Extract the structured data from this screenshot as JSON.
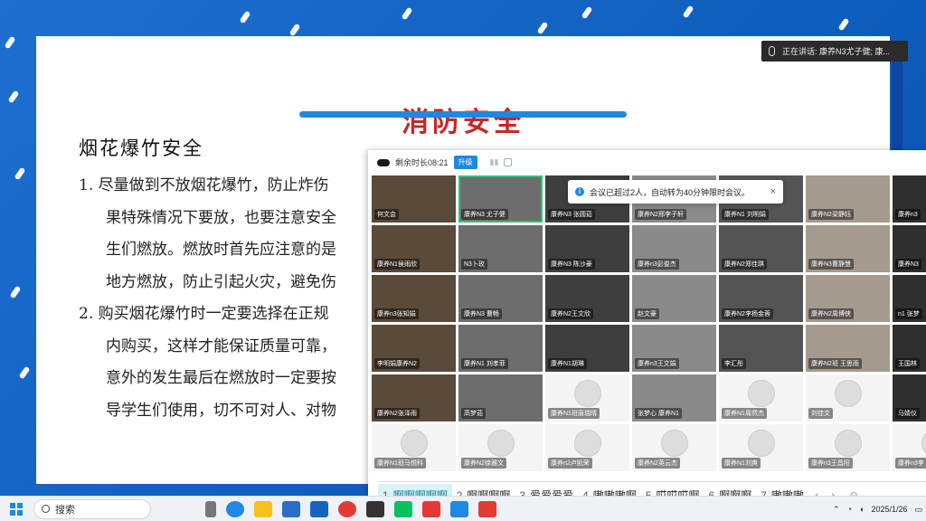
{
  "slide": {
    "title": "消防安全",
    "subtitle": "烟花爆竹安全",
    "lines": [
      "1.  尽量做到不放烟花爆竹，防止炸伤",
      "果特殊情况下要放，也要注意安全",
      "生们燃放。燃放时首先应注意的是",
      "地方燃放，防止引起火灾，避免伤",
      "2.  购买烟花爆竹时一定要选择在正规",
      "内购买，这样才能保证质量可靠，",
      "意外的发生最后在燃放时一定要按",
      "导学生们使用，切不可对人、对物"
    ]
  },
  "speaking": {
    "text": "正在讲话: 康养N3尤子健; 康..."
  },
  "meeting": {
    "remaining": "剩余时长08:21",
    "upgrade": "升级",
    "notice": "会议已超过2人，自动转为40分钟限时会议。",
    "participants": [
      "何文会",
      "康养N3 尤子健",
      "康养N3 张圆茹",
      "康养N2邢李子轩",
      "康养N1 刘明娟",
      "康养N2梁静钰",
      "康养n3",
      "康养N1侯雨欣",
      "N3卜玫",
      "康养N3 陈沙豪",
      "康养n3彭俊杰",
      "康养N2郑佳琪",
      "康养N3曹静慧",
      "康养N3",
      "康养n3张知娟",
      "康养N3 曹畅",
      "康养N2王文欣",
      "赵文豪",
      "康养N2李杨金蓉",
      "康养N2周博侠",
      "n1 张梦",
      "李明娟康养N2",
      "康养N1 刘孝菲",
      "康养N1胡琳",
      "康养n3王文娟",
      "李汇彤",
      "康养N2班 王思雨",
      "王国林",
      "康养N2张泽雨",
      "高梦茹",
      "康养N1班唐瑞晴",
      "张梦心 康养N1",
      "康养N1周然杰",
      "刘佳文",
      "马婧仪",
      "康养N1班马悦科",
      "康养N2徐雅文",
      "康养n2卢凯荣",
      "康养N2英云杰",
      "康养N1刘爽",
      "康养n3王昌阳",
      "康养n3李"
    ]
  },
  "ime": {
    "candidates": [
      {
        "n": "1",
        "text": "啊啊啊啊啊"
      },
      {
        "n": "2",
        "text": "啊啊啊啊"
      },
      {
        "n": "3",
        "text": "爱爱爱爱"
      },
      {
        "n": "4",
        "text": "嗷嗷嗷啊"
      },
      {
        "n": "5",
        "text": "哎哎哎啊"
      },
      {
        "n": "6",
        "text": "啊啊啊"
      },
      {
        "n": "7",
        "text": "嗷嗷嗷"
      }
    ]
  },
  "taskbar": {
    "search_placeholder": "搜索",
    "date": "2025/1/26"
  }
}
